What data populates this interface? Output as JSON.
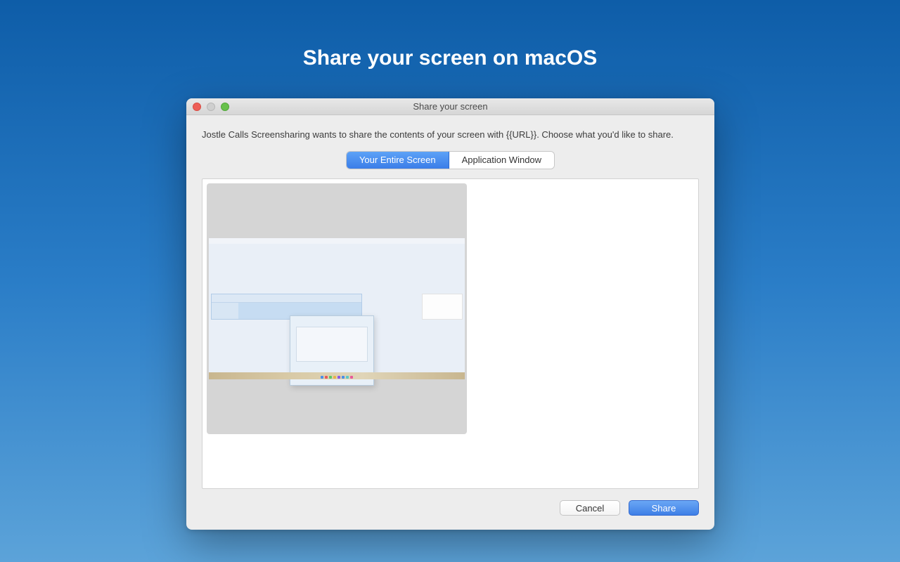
{
  "page": {
    "title": "Share your screen on macOS"
  },
  "window": {
    "title": "Share your screen",
    "instruction": "Jostle Calls Screensharing wants to share the contents of your screen with {{URL}}. Choose what you'd like to share.",
    "tabs": [
      {
        "label": "Your Entire Screen",
        "active": true
      },
      {
        "label": "Application Window",
        "active": false
      }
    ],
    "buttons": {
      "cancel": "Cancel",
      "share": "Share"
    }
  }
}
